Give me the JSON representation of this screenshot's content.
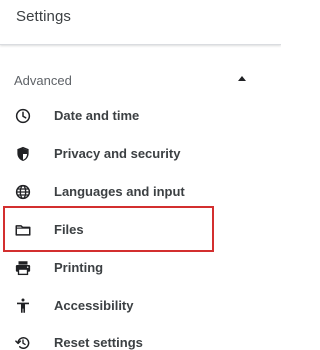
{
  "header": {
    "title": "Settings"
  },
  "section": {
    "title": "Advanced",
    "toggle_icon": "chevron-up-icon",
    "expanded": true
  },
  "items": [
    {
      "label": "Date and time",
      "icon": "clock-icon"
    },
    {
      "label": "Privacy and security",
      "icon": "shield-icon"
    },
    {
      "label": "Languages and input",
      "icon": "globe-icon"
    },
    {
      "label": "Files",
      "icon": "folder-icon"
    },
    {
      "label": "Printing",
      "icon": "printer-icon"
    },
    {
      "label": "Accessibility",
      "icon": "accessibility-icon"
    },
    {
      "label": "Reset settings",
      "icon": "reset-icon"
    }
  ],
  "colors": {
    "text": "#3c4043",
    "icon": "#202124",
    "highlight": "#d32f2f"
  }
}
